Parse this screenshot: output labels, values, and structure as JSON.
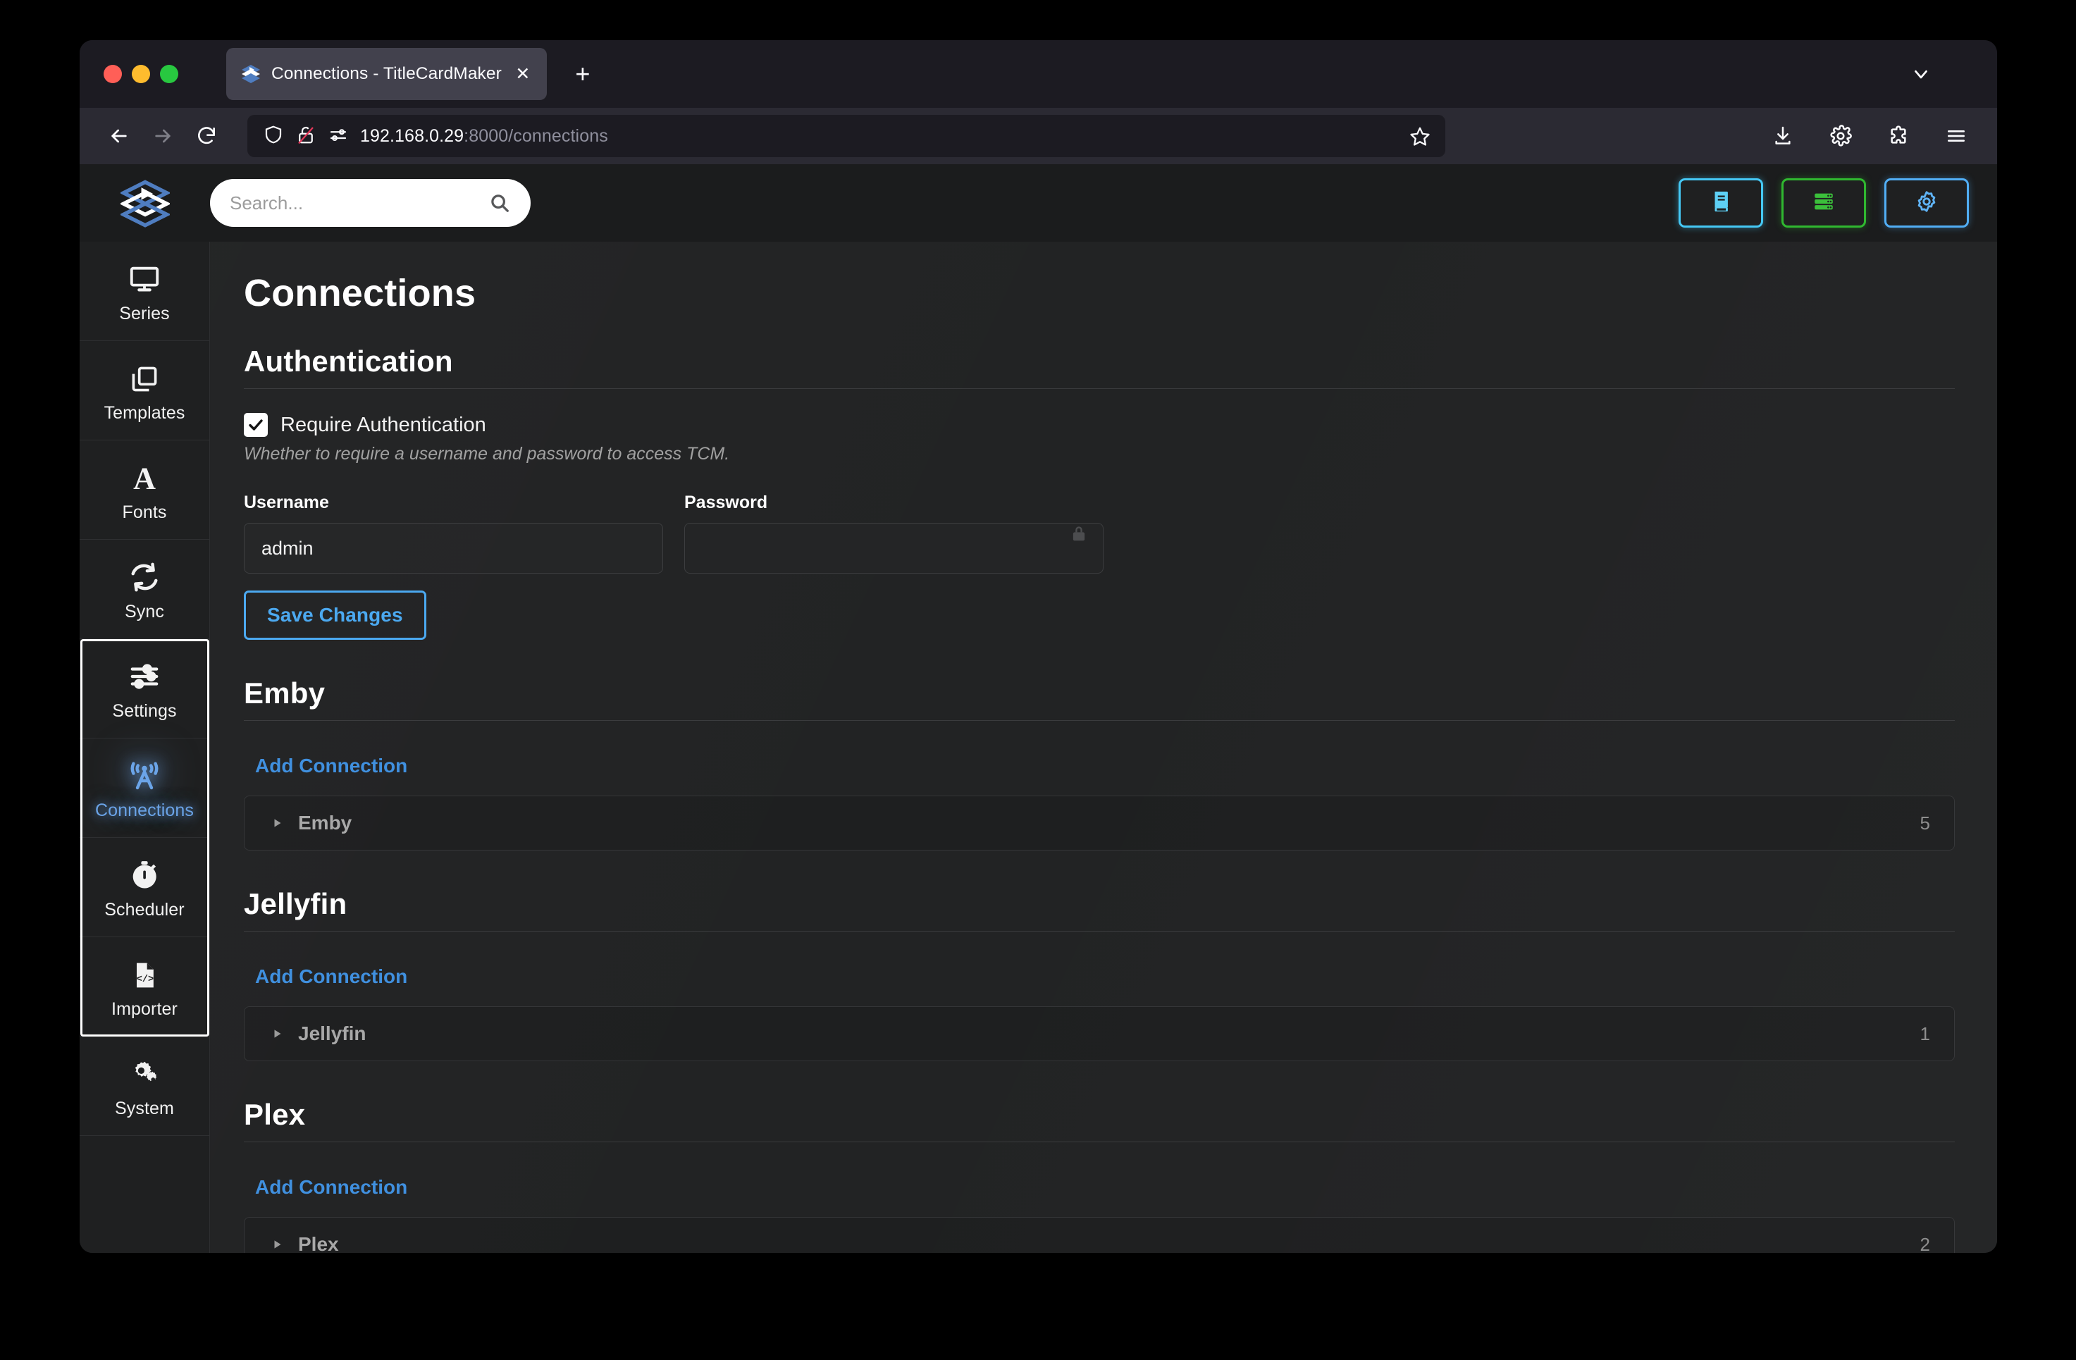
{
  "browser": {
    "tab": {
      "title": "Connections - TitleCardMaker",
      "favicon_icon": "titlecardmaker-layers-icon",
      "close_label": "✕"
    },
    "new_tab_label": "+",
    "nav": {
      "back_icon": "arrow-left-icon",
      "forward_icon": "arrow-right-icon",
      "reload_icon": "reload-icon"
    },
    "url": {
      "host": "192.168.0.29",
      "rest": ":8000/connections",
      "shield_icon": "shield-icon",
      "lock_broken_icon": "lock-broken-icon",
      "permissions_icon": "permissions-icon",
      "bookmark_icon": "star-icon"
    },
    "toolbar_icons": [
      "download-icon",
      "gear-icon",
      "extensions-icon",
      "menu-icon"
    ],
    "tab_list_icon": "chevron-down-icon"
  },
  "app": {
    "brand": {
      "logo_icon": "titlecardmaker-logo-icon"
    },
    "search": {
      "value": "",
      "placeholder": "Search...",
      "icon": "search-icon"
    },
    "topbar_actions": [
      {
        "name": "documentation-button",
        "icon": "book-icon",
        "color": "#45c8f5"
      },
      {
        "name": "server-status-button",
        "icon": "server-icon",
        "color": "#30b830"
      },
      {
        "name": "settings-button",
        "icon": "gear-icon",
        "color": "#51aef5"
      }
    ],
    "sidebar": {
      "items": [
        {
          "label": "Series",
          "icon": "monitor-icon",
          "active": false
        },
        {
          "label": "Templates",
          "icon": "copy-icon",
          "active": false
        },
        {
          "label": "Fonts",
          "icon": "font-a-icon",
          "active": false
        },
        {
          "label": "Sync",
          "icon": "sync-icon",
          "active": false
        },
        {
          "label": "Settings",
          "icon": "sliders-icon",
          "active": false
        },
        {
          "label": "Connections",
          "icon": "broadcast-tower-icon",
          "active": true
        },
        {
          "label": "Scheduler",
          "icon": "stopwatch-icon",
          "active": false
        },
        {
          "label": "Importer",
          "icon": "file-code-icon",
          "active": false
        },
        {
          "label": "System",
          "icon": "gears-icon",
          "active": false
        }
      ]
    },
    "page": {
      "title": "Connections",
      "auth": {
        "heading": "Authentication",
        "require_label": "Require Authentication",
        "require_checked": true,
        "help": "Whether to require a username and password to access TCM.",
        "username_label": "Username",
        "username_value": "admin",
        "username_placeholder": "",
        "password_label": "Password",
        "password_value": "",
        "password_placeholder": "",
        "password_lock_icon": "lock-icon",
        "save_label": "Save Changes"
      },
      "sections": [
        {
          "heading": "Emby",
          "add_label": "Add Connection",
          "connection_label": "Emby",
          "count": "5"
        },
        {
          "heading": "Jellyfin",
          "add_label": "Add Connection",
          "connection_label": "Jellyfin",
          "count": "1"
        },
        {
          "heading": "Plex",
          "add_label": "Add Connection",
          "connection_label": "Plex",
          "count": "2"
        }
      ]
    }
  }
}
